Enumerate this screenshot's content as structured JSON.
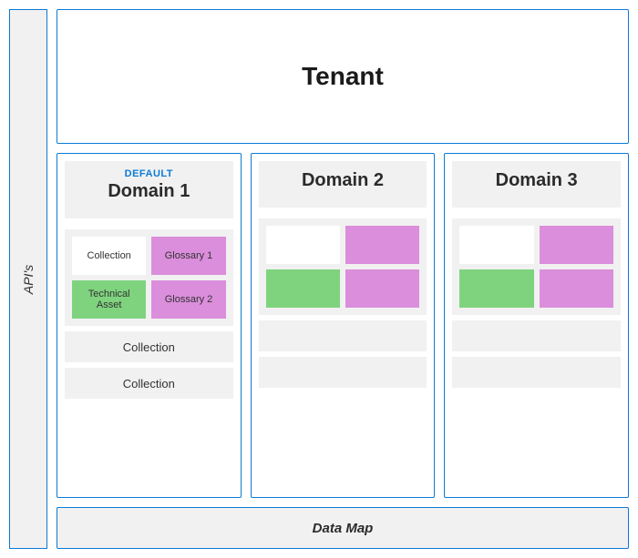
{
  "sidebar": {
    "label": "API's"
  },
  "tenant": {
    "label": "Tenant"
  },
  "datamap": {
    "label": "Data Map"
  },
  "domains": [
    {
      "badge": "DEFAULT",
      "title": "Domain 1",
      "collections": [
        {
          "type": "detailed",
          "collection_label": "Collection",
          "asset_label": "Technical Asset",
          "glossary1_label": "Glossary 1",
          "glossary2_label": "Glossary 2"
        },
        {
          "type": "label",
          "label": "Collection"
        },
        {
          "type": "label",
          "label": "Collection"
        }
      ]
    },
    {
      "badge": "",
      "title": "Domain 2",
      "collections": [
        {
          "type": "detailed",
          "collection_label": "",
          "asset_label": "",
          "glossary1_label": "",
          "glossary2_label": ""
        },
        {
          "type": "label",
          "label": ""
        },
        {
          "type": "label",
          "label": ""
        }
      ]
    },
    {
      "badge": "",
      "title": "Domain 3",
      "collections": [
        {
          "type": "detailed",
          "collection_label": "",
          "asset_label": "",
          "glossary1_label": "",
          "glossary2_label": ""
        },
        {
          "type": "label",
          "label": ""
        },
        {
          "type": "label",
          "label": ""
        }
      ]
    }
  ],
  "colors": {
    "border": "#0b7bd6",
    "panel": "#f1f1f1",
    "asset": "#7fd37f",
    "glossary": "#db8edb"
  }
}
